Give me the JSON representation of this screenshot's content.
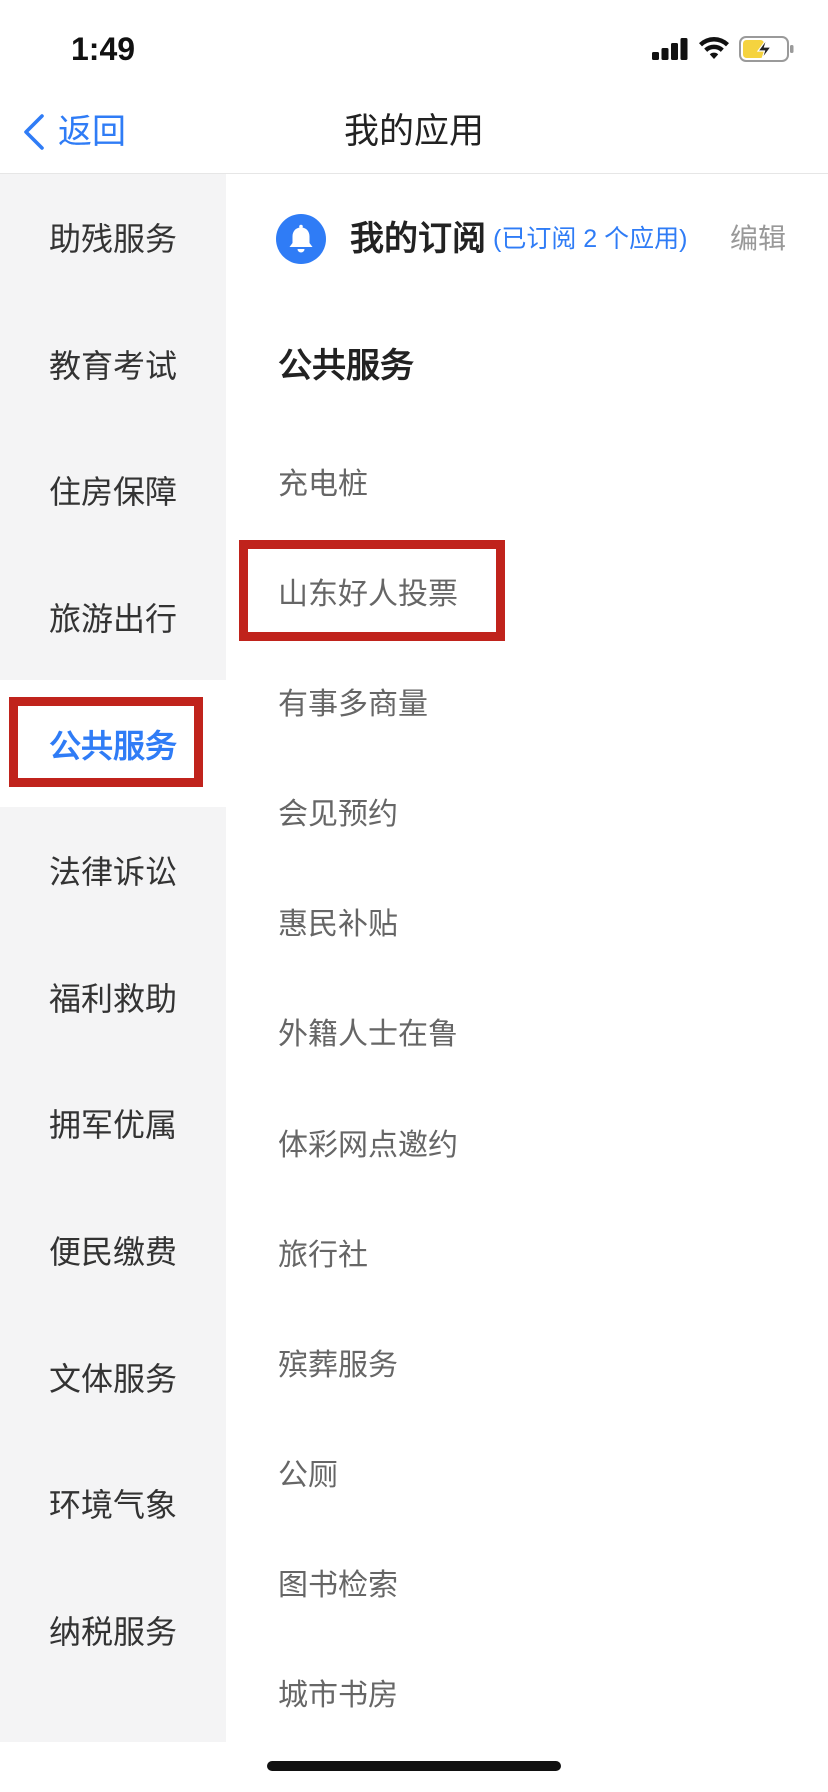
{
  "status_bar": {
    "time": "1:49",
    "signal_bars": 4,
    "wifi_icon": "wifi-icon",
    "battery": {
      "level": 0.5,
      "charging": true,
      "fill_color": "#f5d33f"
    }
  },
  "nav": {
    "back_icon": "chevron-left-icon",
    "back_label": "返回",
    "title": "我的应用"
  },
  "sidebar": {
    "items": [
      {
        "label": "助残服务",
        "selected": false
      },
      {
        "label": "教育考试",
        "selected": false
      },
      {
        "label": "住房保障",
        "selected": false
      },
      {
        "label": "旅游出行",
        "selected": false
      },
      {
        "label": "公共服务",
        "selected": true
      },
      {
        "label": "法律诉讼",
        "selected": false
      },
      {
        "label": "福利救助",
        "selected": false
      },
      {
        "label": "拥军优属",
        "selected": false
      },
      {
        "label": "便民缴费",
        "selected": false
      },
      {
        "label": "文体服务",
        "selected": false
      },
      {
        "label": "环境气象",
        "selected": false
      },
      {
        "label": "纳税服务",
        "selected": false
      }
    ]
  },
  "subscription": {
    "icon": "bell-icon",
    "title": "我的订阅",
    "count_text": "(已订阅 2 个应用)",
    "edit_label": "编辑"
  },
  "section": {
    "title": "公共服务",
    "items": [
      "充电桩",
      "山东好人投票",
      "有事多商量",
      "会见预约",
      "惠民补贴",
      "外籍人士在鲁",
      "体彩网点邀约",
      "旅行社",
      "殡葬服务",
      "公厕",
      "图书检索",
      "城市书房"
    ]
  },
  "colors": {
    "accent": "#2f7cf6",
    "highlight": "#c0231c",
    "sidebar_bg": "#f4f4f5"
  }
}
